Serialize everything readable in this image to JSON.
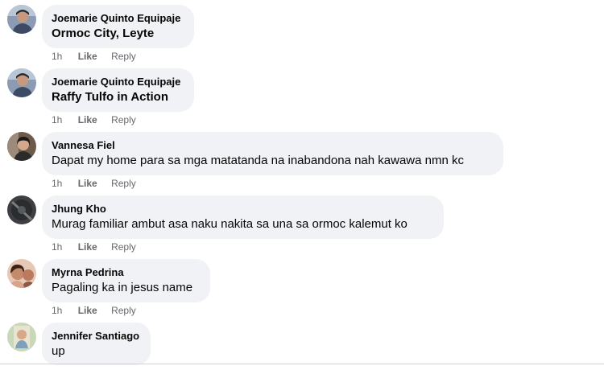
{
  "comments": [
    {
      "author": "Joemarie Quinto Equipaje",
      "text": "Ormoc City, Leyte",
      "time": "1h",
      "like": "Like",
      "reply": "Reply"
    },
    {
      "author": "Joemarie Quinto Equipaje",
      "text": "Raffy Tulfo in Action",
      "time": "1h",
      "like": "Like",
      "reply": "Reply"
    },
    {
      "author": "Vannesa Fiel",
      "text": "Dapat my home para sa mga matatanda na inabandona nah kawawa nmn kc",
      "time": "1h",
      "like": "Like",
      "reply": "Reply"
    },
    {
      "author": "Jhung Kho",
      "text": "Murag familiar ambut asa naku nakita sa una sa ormoc kalemut ko",
      "time": "1h",
      "like": "Like",
      "reply": "Reply"
    },
    {
      "author": "Myrna Pedrina",
      "text": "Pagaling ka in jesus name",
      "time": "1h",
      "like": "Like",
      "reply": "Reply"
    },
    {
      "author": "Jennifer Santiago",
      "text": "up"
    }
  ],
  "icons": {
    "avatar": "user-avatar-icon"
  },
  "colors": {
    "bubble": "#f0f2f5",
    "meta_text": "#65676b",
    "text": "#050505"
  }
}
